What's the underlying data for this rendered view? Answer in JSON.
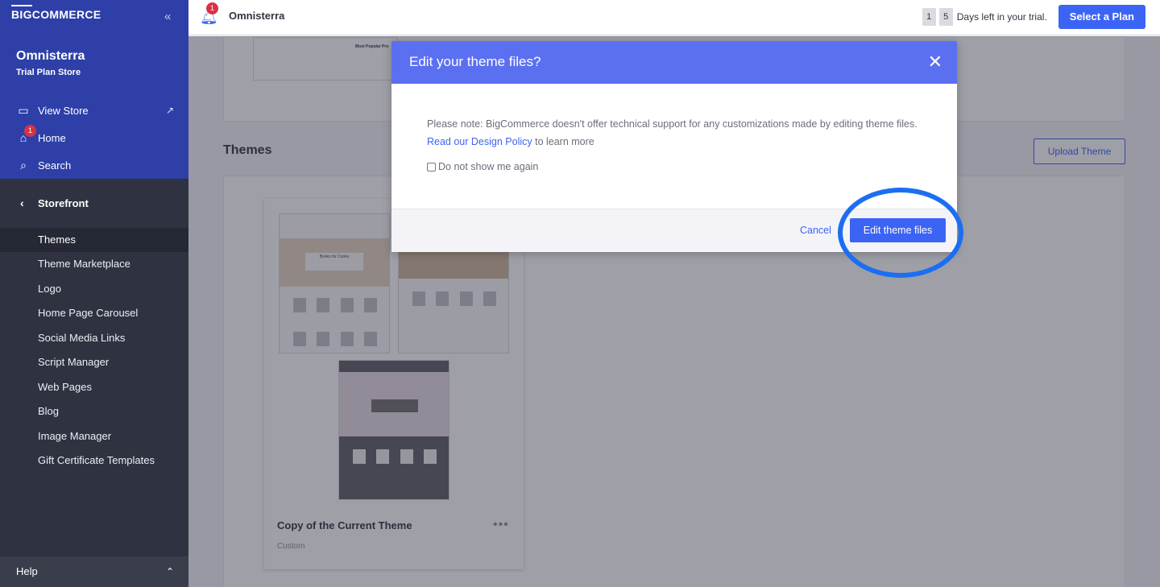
{
  "sidebar": {
    "logo": "BIGCOMMERCE",
    "logo_big": "BIG",
    "logo_rest": "COMMERCE",
    "collapse_icon": "double-chevron-left-icon",
    "store_name": "Omnisterra",
    "store_plan": "Trial Plan Store",
    "nav": [
      {
        "label": "View Store",
        "icon": "storefront-icon"
      },
      {
        "label": "Home",
        "icon": "home-icon",
        "badge": "1"
      },
      {
        "label": "Search",
        "icon": "search-icon"
      }
    ],
    "section_label": "Storefront",
    "menu": [
      {
        "label": "Themes",
        "active": true
      },
      {
        "label": "Theme Marketplace"
      },
      {
        "label": "Logo"
      },
      {
        "label": "Home Page Carousel"
      },
      {
        "label": "Social Media Links"
      },
      {
        "label": "Script Manager"
      },
      {
        "label": "Web Pages"
      },
      {
        "label": "Blog"
      },
      {
        "label": "Image Manager"
      },
      {
        "label": "Gift Certificate Templates"
      }
    ],
    "help_label": "Help"
  },
  "topbar": {
    "bell_badge": "1",
    "store_name": "Omnisterra",
    "trial_digit_1": "1",
    "trial_digit_2": "5",
    "trial_text": "Days left in your trial.",
    "select_plan": "Select a Plan"
  },
  "main": {
    "mini_title": "Most Popular Pro",
    "themes_title": "Themes",
    "upload_theme": "Upload Theme",
    "theme_card": {
      "name": "Copy of the Current Theme",
      "subtitle": "Custom",
      "thumb1_caption": "Books for Cooks"
    }
  },
  "modal": {
    "title": "Edit your theme files?",
    "body_before": "Please note: BigCommerce doesn't offer technical support for any customizations made by editing theme files. ",
    "body_link": "Read our Design Policy",
    "body_after": " to learn more",
    "checkbox_label": "Do not show me again",
    "cancel": "Cancel",
    "confirm": "Edit theme files"
  },
  "colors": {
    "accent": "#3c64f4",
    "highlight_ring": "#1b6ef2",
    "badge": "#d63344"
  }
}
